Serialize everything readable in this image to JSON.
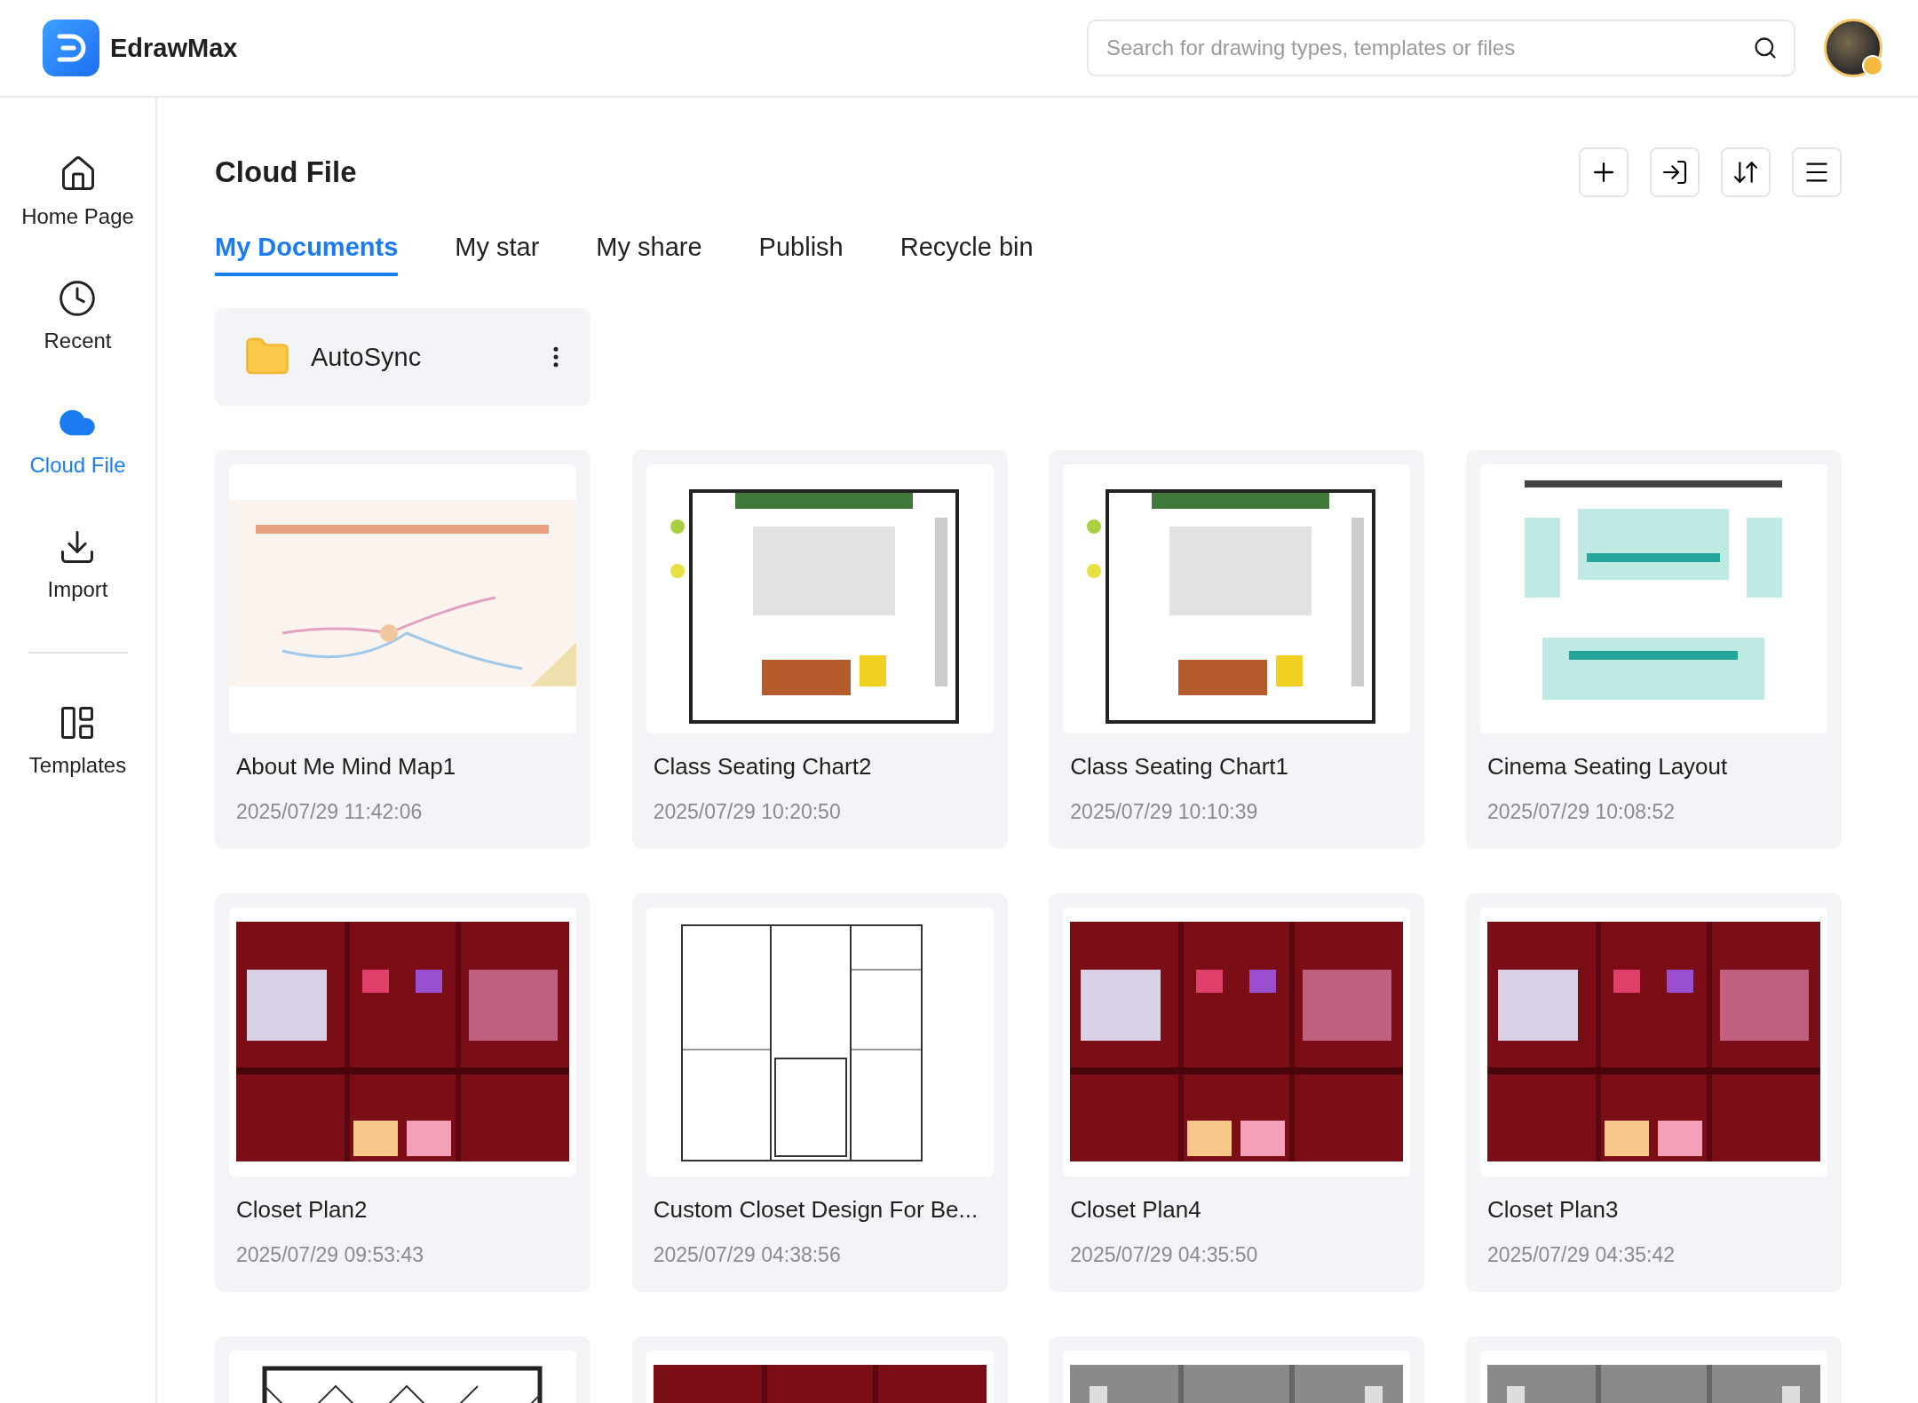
{
  "app": {
    "name": "EdrawMax"
  },
  "search": {
    "placeholder": "Search for drawing types, templates or files"
  },
  "sidebar": {
    "items": [
      {
        "label": "Home Page",
        "selected": false
      },
      {
        "label": "Recent",
        "selected": false
      },
      {
        "label": "Cloud File",
        "selected": true
      },
      {
        "label": "Import",
        "selected": false
      },
      {
        "label": "Templates",
        "selected": false
      }
    ]
  },
  "page": {
    "title": "Cloud File"
  },
  "tabs": [
    {
      "label": "My Documents",
      "selected": true
    },
    {
      "label": "My star",
      "selected": false
    },
    {
      "label": "My share",
      "selected": false
    },
    {
      "label": "Publish",
      "selected": false
    },
    {
      "label": "Recycle bin",
      "selected": false
    }
  ],
  "folders": [
    {
      "name": "AutoSync"
    }
  ],
  "files": [
    {
      "title": "About Me Mind Map1",
      "date": "2025/07/29 11:42:06"
    },
    {
      "title": "Class Seating Chart2",
      "date": "2025/07/29 10:20:50"
    },
    {
      "title": "Class Seating Chart1",
      "date": "2025/07/29 10:10:39"
    },
    {
      "title": "Cinema Seating Layout",
      "date": "2025/07/29 10:08:52"
    },
    {
      "title": "Closet Plan2",
      "date": "2025/07/29 09:53:43"
    },
    {
      "title": "Custom Closet Design For Be...",
      "date": "2025/07/29 04:38:56"
    },
    {
      "title": "Closet Plan4",
      "date": "2025/07/29 04:35:50"
    },
    {
      "title": "Closet Plan3",
      "date": "2025/07/29 04:35:42"
    },
    {
      "kind": "picture"
    },
    {
      "kind": "picture"
    },
    {
      "kind": "picture"
    },
    {
      "kind": "picture"
    }
  ]
}
